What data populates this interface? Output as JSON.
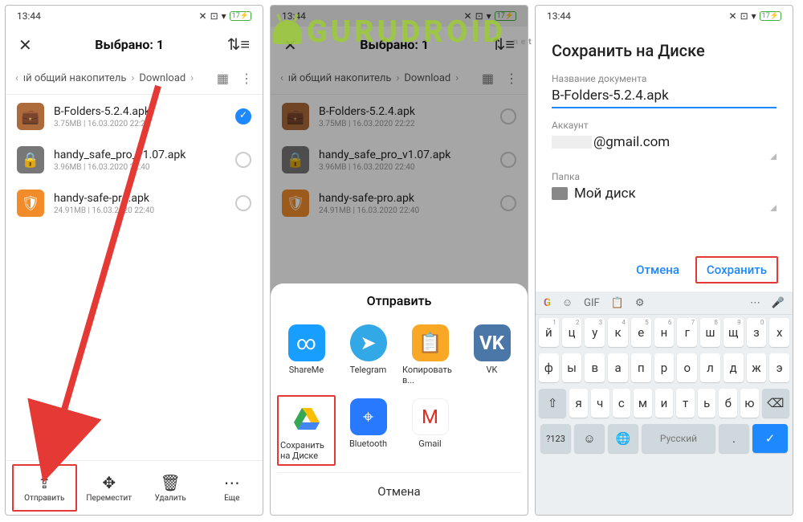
{
  "watermark": {
    "text": "GURUDROID",
    "suffix": ".net"
  },
  "status": {
    "time": "13:44",
    "battery": "17"
  },
  "phone1": {
    "header_title": "Выбрано: 1",
    "breadcrumb": {
      "part1": "ıй общий накопитель",
      "part2": "Download"
    },
    "files": [
      {
        "name": "B-Folders-5.2.4.apk",
        "meta": "3.75MB | 16.03.2020 22:22",
        "icon": "brown",
        "checked": true
      },
      {
        "name": "handy_safe_pro_v1.07.apk",
        "meta": "3.96MB | 16.03.2020 22:40",
        "icon": "grey",
        "checked": false
      },
      {
        "name": "handy-safe-pro.apk",
        "meta": "24.91MB | 16.03.2020 22:40",
        "icon": "orange",
        "checked": false
      }
    ],
    "bottom": {
      "send": "Отправить",
      "move": "Переместит",
      "delete": "Удалить",
      "more": "Еще"
    }
  },
  "phone2": {
    "sheet_title": "Отправить",
    "apps": {
      "shareme": "ShareMe",
      "telegram": "Telegram",
      "copy": "Копировать в...",
      "vk": "VK",
      "drive": "Сохранить на Диске",
      "bluetooth": "Bluetooth",
      "gmail": "Gmail"
    },
    "cancel": "Отмена"
  },
  "phone3": {
    "title": "Сохранить на Диске",
    "doc_label": "Название документа",
    "doc_value": "B-Folders-5.2.4.apk",
    "account_label": "Аккаунт",
    "account_value": "@gmail.com",
    "folder_label": "Папка",
    "folder_value": "Мой диск",
    "cancel": "Отмена",
    "save": "Сохранить",
    "keyboard": {
      "row1": [
        "й",
        "ц",
        "у",
        "к",
        "е",
        "н",
        "г",
        "ш",
        "щ",
        "з",
        "х"
      ],
      "row1_nums": [
        "1",
        "2",
        "3",
        "4",
        "5",
        "6",
        "7",
        "8",
        "9",
        "0",
        ""
      ],
      "row2": [
        "ф",
        "ы",
        "в",
        "а",
        "п",
        "р",
        "о",
        "л",
        "д",
        "ж",
        "э"
      ],
      "row3": [
        "я",
        "ч",
        "с",
        "м",
        "и",
        "т",
        "ь",
        "б",
        "ю"
      ],
      "numkey": "?123",
      "space": "Русский"
    }
  }
}
